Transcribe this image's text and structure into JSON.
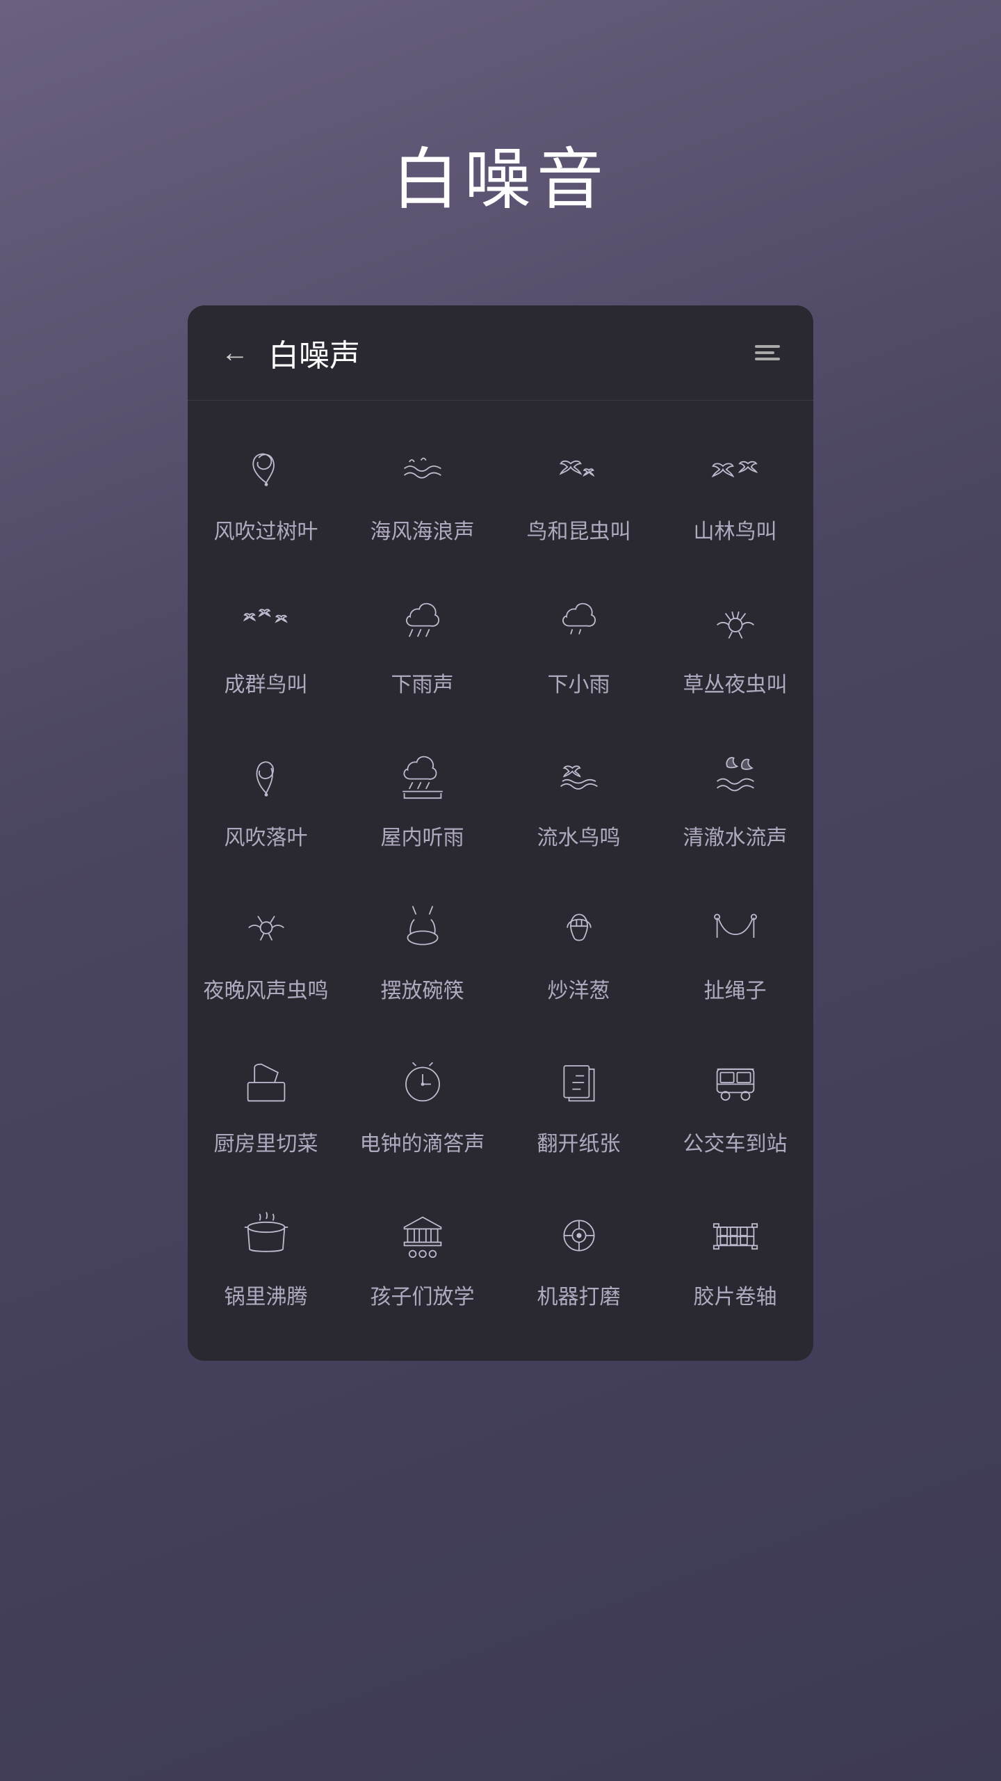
{
  "page": {
    "title": "白噪音",
    "background_gradient": [
      "#6b6080",
      "#4a4560",
      "#3d3a55"
    ]
  },
  "card": {
    "header": {
      "back_label": "←",
      "title": "白噪声",
      "playlist_icon": "playlist-icon"
    },
    "items": [
      {
        "id": "wind-leaves",
        "label": "风吹过树叶",
        "icon": "wind-leaves"
      },
      {
        "id": "sea-waves",
        "label": "海风海浪声",
        "icon": "sea-waves"
      },
      {
        "id": "birds-insects",
        "label": "鸟和昆虫叫",
        "icon": "birds-insects"
      },
      {
        "id": "forest-birds",
        "label": "山林鸟叫",
        "icon": "forest-birds"
      },
      {
        "id": "flock-birds",
        "label": "成群鸟叫",
        "icon": "flock-birds"
      },
      {
        "id": "rain",
        "label": "下雨声",
        "icon": "rain"
      },
      {
        "id": "light-rain",
        "label": "下小雨",
        "icon": "light-rain"
      },
      {
        "id": "night-insects",
        "label": "草丛夜虫叫",
        "icon": "night-insects"
      },
      {
        "id": "falling-leaves",
        "label": "风吹落叶",
        "icon": "falling-leaves"
      },
      {
        "id": "indoor-rain",
        "label": "屋内听雨",
        "icon": "indoor-rain"
      },
      {
        "id": "stream-birds",
        "label": "流水鸟鸣",
        "icon": "stream-birds"
      },
      {
        "id": "clear-stream",
        "label": "清澈水流声",
        "icon": "clear-stream"
      },
      {
        "id": "night-wind-bugs",
        "label": "夜晚风声虫鸣",
        "icon": "night-wind-bugs"
      },
      {
        "id": "chopsticks",
        "label": "摆放碗筷",
        "icon": "chopsticks"
      },
      {
        "id": "fry-onion",
        "label": "炒洋葱",
        "icon": "fry-onion"
      },
      {
        "id": "jump-rope",
        "label": "扯绳子",
        "icon": "jump-rope"
      },
      {
        "id": "kitchen-chop",
        "label": "厨房里切菜",
        "icon": "kitchen-chop"
      },
      {
        "id": "clock-tick",
        "label": "电钟的滴答声",
        "icon": "clock-tick"
      },
      {
        "id": "flip-paper",
        "label": "翻开纸张",
        "icon": "flip-paper"
      },
      {
        "id": "bus-stop",
        "label": "公交车到站",
        "icon": "bus-stop"
      },
      {
        "id": "pot-boil",
        "label": "锅里沸腾",
        "icon": "pot-boil"
      },
      {
        "id": "school-out",
        "label": "孩子们放学",
        "icon": "school-out"
      },
      {
        "id": "machine-grind",
        "label": "机器打磨",
        "icon": "machine-grind"
      },
      {
        "id": "film-reel",
        "label": "胶片卷轴",
        "icon": "film-reel"
      }
    ]
  }
}
